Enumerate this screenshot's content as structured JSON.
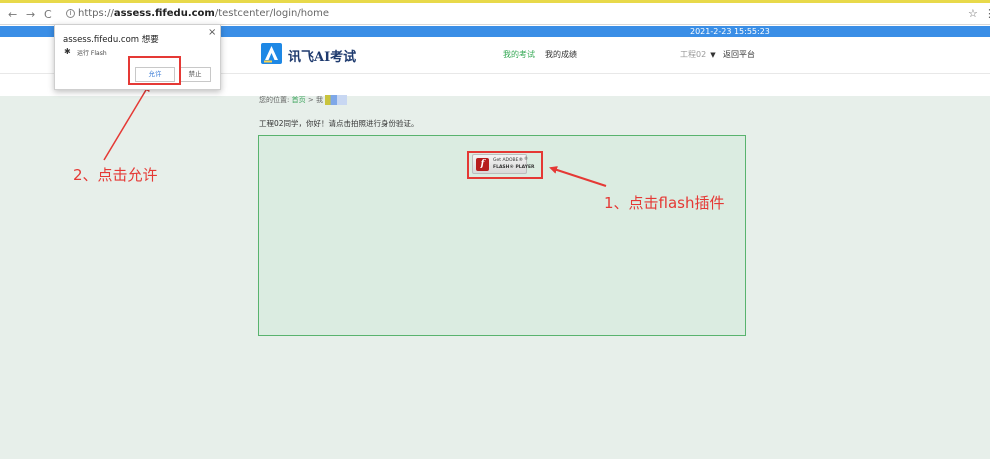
{
  "browser": {
    "back": "←",
    "forward": "→",
    "reload": "C",
    "info": "i",
    "url_prefix": "https://",
    "url_host": "assess.fifedu.com",
    "url_path": "/testcenter/login/home",
    "star": "☆",
    "menu": "⋮"
  },
  "topbar": {
    "datetime": "2021-2-23 15:55:23"
  },
  "header": {
    "logo_text": "讯飞AI考试",
    "nav_my_exam": "我的考试",
    "nav_my_score": "我的成绩",
    "user_name": "工程02",
    "user_caret": "▼",
    "back_platform": "返回平台"
  },
  "breadcrumb": {
    "label": "您的位置:",
    "home": "首页",
    "separator": ">",
    "current": "我"
  },
  "greeting": "工程02同学，你好！请点击拍照进行身份验证。",
  "flash": {
    "logo": "f",
    "get_text": "Get ADOBE®",
    "name_text": "FLASH® PLAYER",
    "mark": "®"
  },
  "popup": {
    "title": "assess.fifedu.com 想要",
    "close": "×",
    "puzzle_icon": "✱",
    "permission": "运行 Flash",
    "allow": "允许",
    "deny": "禁止"
  },
  "annotations": {
    "step1": "1、点击flash插件",
    "step2": "2、点击允许",
    "color": "#e53935"
  },
  "colors": {
    "accent_blue": "#3a8ee6",
    "accent_green": "#33a853",
    "content_bg": "#e7efea"
  }
}
